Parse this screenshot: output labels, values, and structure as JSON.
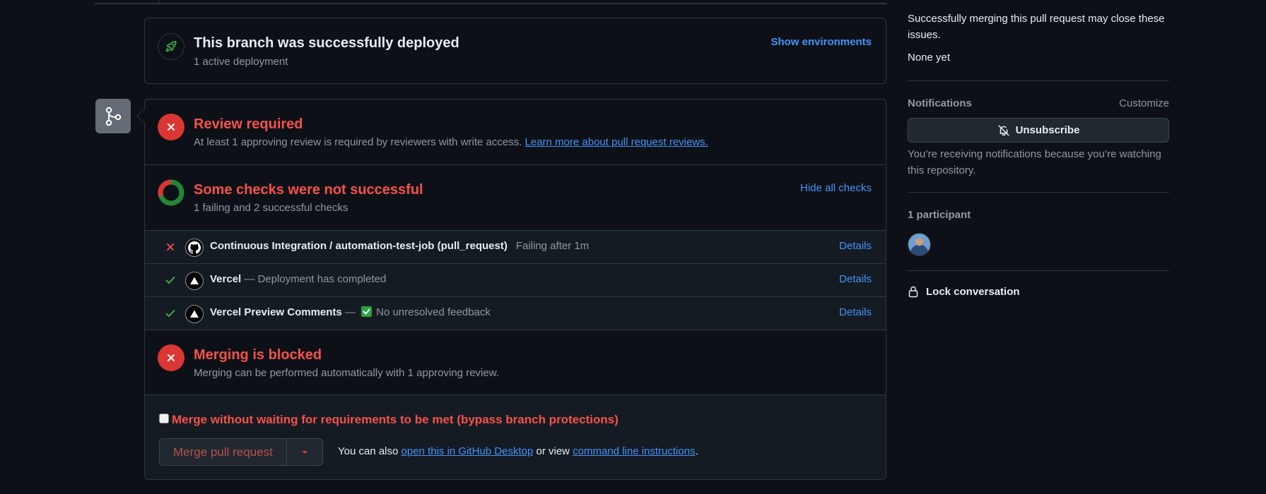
{
  "deployment": {
    "title": "This branch was successfully deployed",
    "subtitle": "1 active deployment",
    "action": "Show environments"
  },
  "review": {
    "title": "Review required",
    "description": "At least 1 approving review is required by reviewers with write access.",
    "link": "Learn more about pull request reviews."
  },
  "checks": {
    "title": "Some checks were not successful",
    "subtitle": "1 failing and 2 successful checks",
    "toggle": "Hide all checks",
    "items": [
      {
        "status": "failing",
        "avatar_icon": "github-icon",
        "name": "Continuous Integration / automation-test-job (pull_request)",
        "note": "Failing after 1m",
        "action": "Details"
      },
      {
        "status": "success",
        "avatar_icon": "vercel-icon",
        "name": "Vercel",
        "separator": "—",
        "note": "Deployment has completed",
        "action": "Details"
      },
      {
        "status": "success",
        "avatar_icon": "vercel-icon",
        "name": "Vercel Preview Comments",
        "separator": "—",
        "note": "No unresolved feedback",
        "action": "Details"
      }
    ]
  },
  "blocked": {
    "title": "Merging is blocked",
    "subtitle": "Merging can be performed automatically with 1 approving review."
  },
  "bypass": {
    "label": "Merge without waiting for requirements to be met (bypass branch protections)",
    "checked": false,
    "merge_button": "Merge pull request",
    "also_prefix": "You can also",
    "desktop_link": "open this in GitHub Desktop",
    "or_view": "or view",
    "cli_link": "command line instructions",
    "period": "."
  },
  "sidebar": {
    "issues_text": "Successfully merging this pull request may close these issues.",
    "issues_value": "None yet",
    "notifications_heading": "Notifications",
    "customize": "Customize",
    "unsubscribe": "Unsubscribe",
    "notifications_note": "You’re receiving notifications because you’re watching this repository.",
    "participants_heading": "1 participant",
    "lock": "Lock conversation"
  },
  "colors": {
    "background": "#0d1117",
    "danger": "#f85149",
    "success": "#3fb950",
    "link": "#4493f8",
    "muted": "#9198a1"
  }
}
